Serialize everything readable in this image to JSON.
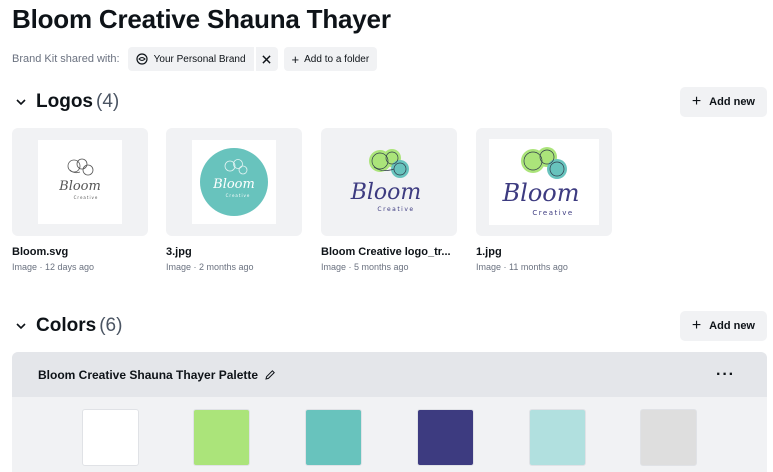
{
  "title": "Bloom Creative Shauna Thayer",
  "shared": {
    "label": "Brand Kit shared with:",
    "brand_chip": "Your Personal Brand",
    "folder_chip": "Add to a folder"
  },
  "logos": {
    "title": "Logos",
    "count": "(4)",
    "add_label": "Add new",
    "items": [
      {
        "name": "Bloom.svg",
        "meta": "Image · 12 days ago",
        "wordmark": "Bloom",
        "sub": "Creative"
      },
      {
        "name": "3.jpg",
        "meta": "Image · 2 months ago",
        "wordmark": "Bloom",
        "sub": "Creative"
      },
      {
        "name": "Bloom Creative logo_tr...",
        "meta": "Image · 5 months ago",
        "wordmark": "Bloom",
        "sub": "Creative"
      },
      {
        "name": "1.jpg",
        "meta": "Image · 11 months ago",
        "wordmark": "Bloom",
        "sub": "Creative"
      }
    ]
  },
  "colors": {
    "title": "Colors",
    "count": "(6)",
    "add_label": "Add new",
    "palette_name": "Bloom Creative Shauna Thayer Palette",
    "more_label": "···",
    "swatches": [
      "#ffffff",
      "#abe47a",
      "#68c3bd",
      "#3d3b80",
      "#b1e0df",
      "#dedede"
    ]
  }
}
